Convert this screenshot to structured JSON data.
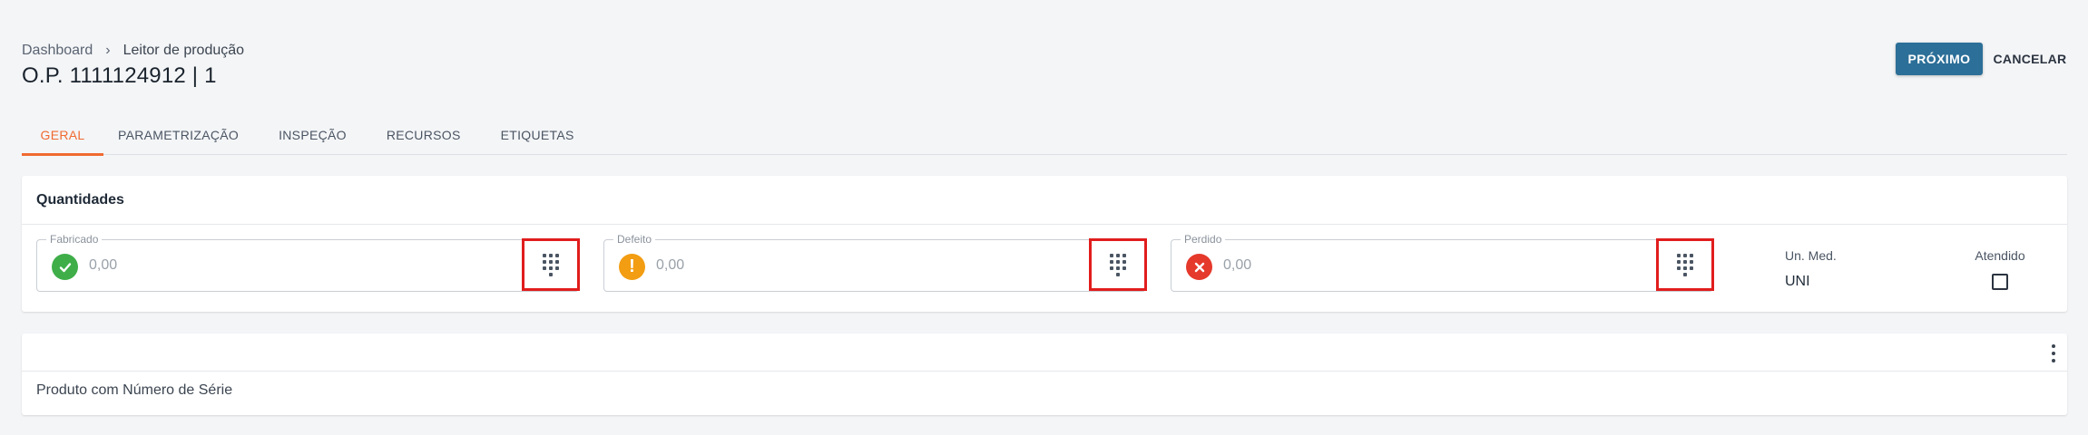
{
  "breadcrumb": {
    "root": "Dashboard",
    "separator": "›",
    "current": "Leitor de produção"
  },
  "page": {
    "title": "O.P. 1111124912 | 1"
  },
  "actions": {
    "next": "PRÓXIMO",
    "cancel": "CANCELAR"
  },
  "tabs": [
    {
      "label": "GERAL",
      "active": true
    },
    {
      "label": "PARAMETRIZAÇÃO"
    },
    {
      "label": "INSPEÇÃO"
    },
    {
      "label": "RECURSOS"
    },
    {
      "label": "ETIQUETAS"
    }
  ],
  "quantities": {
    "header": "Quantidades",
    "fields": [
      {
        "label": "Fabricado",
        "value": "0,00",
        "status_icon": "check-icon",
        "color": "#3fae49"
      },
      {
        "label": "Defeito",
        "value": "0,00",
        "status_icon": "warning-icon",
        "color": "#f29d12"
      },
      {
        "label": "Perdido",
        "value": "0,00",
        "status_icon": "close-icon",
        "color": "#e5392b"
      }
    ],
    "unit": {
      "label": "Un. Med.",
      "value": "UNI"
    },
    "attended": {
      "label": "Atendido",
      "checked": false
    }
  },
  "serial": {
    "label": "Produto com Número de Série"
  },
  "colors": {
    "primary": "#2c6f98",
    "accent": "#f06a30",
    "highlight": "#e11d1d"
  }
}
